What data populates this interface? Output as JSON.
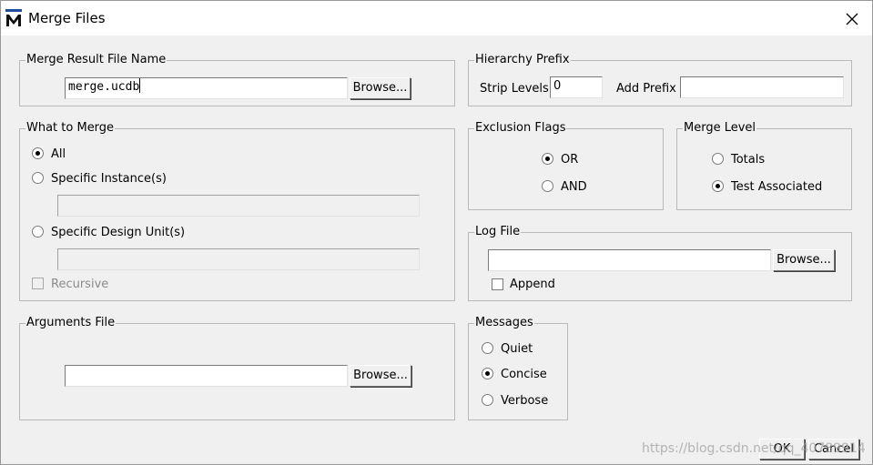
{
  "window": {
    "title": "Merge Files",
    "app_icon": "modelsim-m-icon",
    "close_icon": "close-x-icon"
  },
  "merge_result": {
    "legend": "Merge Result File Name",
    "filename": "merge.ucdb",
    "browse_label": "Browse..."
  },
  "hierarchy_prefix": {
    "legend": "Hierarchy Prefix",
    "strip_levels_label": "Strip Levels",
    "strip_levels_value": "0",
    "add_prefix_label": "Add Prefix",
    "add_prefix_value": ""
  },
  "what_to_merge": {
    "legend": "What to Merge",
    "options": [
      {
        "label": "All",
        "checked": true
      },
      {
        "label": "Specific Instance(s)",
        "checked": false
      },
      {
        "label": "Specific Design Unit(s)",
        "checked": false
      }
    ],
    "instance_value": "",
    "design_unit_value": "",
    "recursive_label": "Recursive"
  },
  "exclusion_flags": {
    "legend": "Exclusion Flags",
    "options": [
      {
        "label": "OR",
        "checked": true
      },
      {
        "label": "AND",
        "checked": false
      }
    ]
  },
  "merge_level": {
    "legend": "Merge Level",
    "options": [
      {
        "label": "Totals",
        "checked": false
      },
      {
        "label": "Test Associated",
        "checked": true
      }
    ]
  },
  "log_file": {
    "legend": "Log File",
    "value": "",
    "browse_label": "Browse...",
    "append_label": "Append"
  },
  "arguments_file": {
    "legend": "Arguments File",
    "value": "",
    "browse_label": "Browse..."
  },
  "messages": {
    "legend": "Messages",
    "options": [
      {
        "label": "Quiet",
        "checked": false
      },
      {
        "label": "Concise",
        "checked": true
      },
      {
        "label": "Verbose",
        "checked": false
      }
    ]
  },
  "footer": {
    "ok_label": "OK",
    "cancel_label": "Cancel",
    "watermark": "https://blog.csdn.net/qq_40789914"
  }
}
